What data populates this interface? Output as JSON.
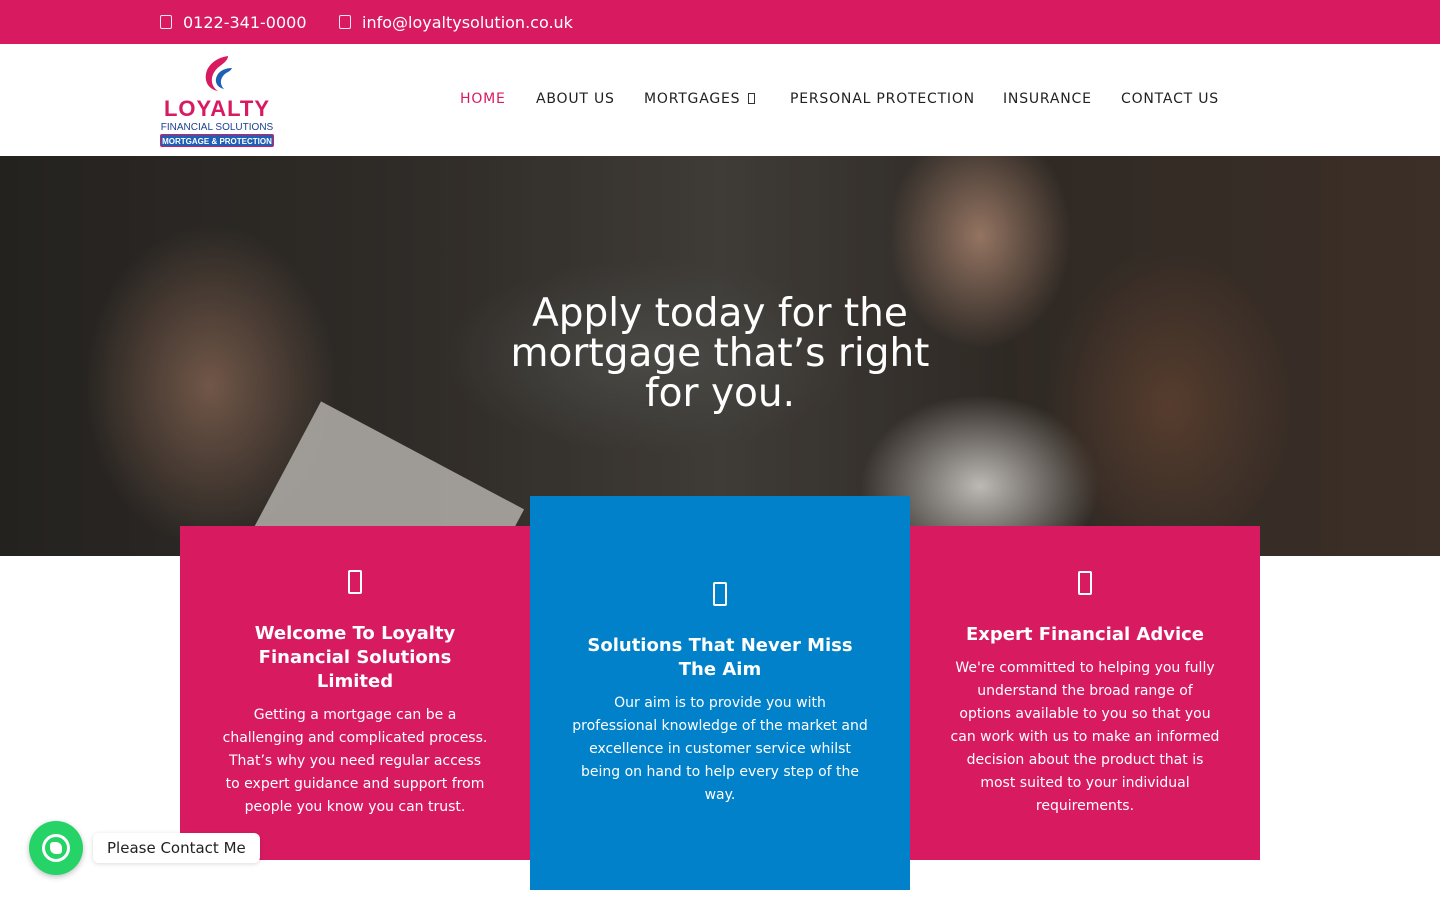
{
  "topbar": {
    "phone": "0122-341-0000",
    "email": "info@loyaltysolution.co.uk",
    "phone_icon": "phone-icon",
    "email_icon": "envelope-icon",
    "background": "#d81b60"
  },
  "logo": {
    "brand": "LOYALTY",
    "subtitle": "FINANCIAL SOLUTIONS",
    "tagline": "MORTGAGE & PROTECTION"
  },
  "nav": {
    "items": [
      {
        "label": "HOME",
        "active": true
      },
      {
        "label": "ABOUT US",
        "active": false
      },
      {
        "label": "MORTGAGES",
        "active": false,
        "dropdown_icon": "chevron-down-icon"
      },
      {
        "label": "PERSONAL PROTECTION",
        "active": false
      },
      {
        "label": "INSURANCE",
        "active": false
      },
      {
        "label": "CONTACT US",
        "active": false
      }
    ],
    "active_color": "#d81b60"
  },
  "hero": {
    "headline": "Apply today for the mortgage that’s right for you."
  },
  "cards": [
    {
      "icon": "home-icon",
      "title": "Welcome To Loyalty Financial Solutions Limited",
      "text": "Getting a mortgage can be a challenging and complicated process. That’s why you need regular access to expert guidance and support from people you know you can trust.",
      "color": "#d81b60"
    },
    {
      "icon": "target-icon",
      "title": "Solutions That Never Miss The Aim",
      "text": "Our aim is to provide you with professional knowledge of the market and excellence in customer service whilst being on hand to help every step of the way.",
      "color": "#0081c9"
    },
    {
      "icon": "advice-icon",
      "title": "Expert Financial Advice",
      "text": "We're committed to helping you fully understand the broad range of options available to you so that you can work with us to make an informed decision about the product that is most suited to your individual requirements.",
      "color": "#d81b60"
    }
  ],
  "chat_widget": {
    "label": "Please Contact Me",
    "icon": "whatsapp-icon",
    "color": "#25d366"
  }
}
